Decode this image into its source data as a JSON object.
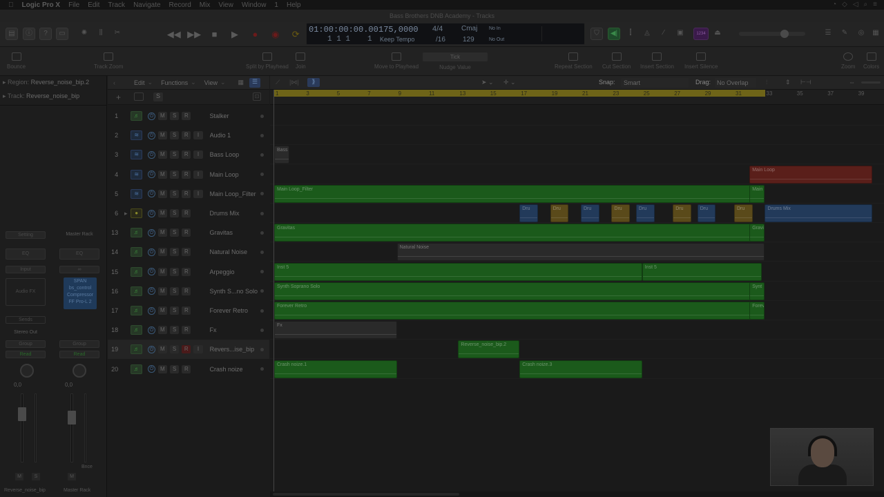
{
  "menubar": {
    "app_name": "Logic Pro X",
    "items": [
      "File",
      "Edit",
      "Track",
      "Navigate",
      "Record",
      "Mix",
      "View",
      "Window",
      "1",
      "Help"
    ]
  },
  "window": {
    "title": "Bass Brothers DNB Academy - Tracks"
  },
  "lcd": {
    "position": "01:00:00:00.00",
    "bars": "1  1  1",
    "beat_div": "1",
    "tempo": "175,0000",
    "tempo_mode": "Keep Tempo",
    "time_sig": "4/4",
    "division": "/16",
    "key": "Cmaj",
    "key_num": "129",
    "in": "No In",
    "out": "No Out",
    "badge": "1234"
  },
  "toolbar": {
    "bounce": "Bounce",
    "track_zoom": "Track Zoom",
    "split": "Split by Playhead",
    "join": "Join",
    "move": "Move to Playhead",
    "nudge": "Nudge Value",
    "nudge_value": "Tick",
    "repeat": "Repeat Section",
    "cut": "Cut Section",
    "insert": "Insert Section",
    "silence": "Insert Silence",
    "zoom": "Zoom",
    "colors": "Colors"
  },
  "inspector": {
    "region_label": "Region:",
    "region_value": "Reverse_noise_bip.2",
    "track_label": "Track:",
    "track_value": "Reverse_noise_bip",
    "strip1": {
      "setting": "Setting",
      "eq": "EQ",
      "input": "Input",
      "audio_fx": "Audio FX",
      "sends": "Sends",
      "output": "Stereo Out",
      "group": "Group",
      "read": "Read",
      "vol": "0,0",
      "m": "M",
      "s": "S",
      "name": "Reverse_noise_bip"
    },
    "strip2": {
      "setting": "Master Rack",
      "eq": "EQ",
      "plugins": [
        "SPAN",
        "bs_control",
        "Compressor",
        "FF Pro-L 2"
      ],
      "group": "Group",
      "read": "Read",
      "vol": "0,0",
      "m": "M",
      "bnce": "Bnce",
      "name": "Master Rack"
    }
  },
  "trackarea": {
    "edit": "Edit",
    "functions": "Functions",
    "view": "View",
    "s": "S",
    "snap_label": "Snap:",
    "snap_value": "Smart",
    "drag_label": "Drag:",
    "drag_value": "No Overlap"
  },
  "tracks": [
    {
      "num": "1",
      "name": "Stalker",
      "type": "midi"
    },
    {
      "num": "2",
      "name": "Audio 1",
      "type": "audio"
    },
    {
      "num": "3",
      "name": "Bass Loop",
      "type": "audio"
    },
    {
      "num": "4",
      "name": "Main Loop",
      "type": "audio"
    },
    {
      "num": "5",
      "name": "Main Loop_Filter",
      "type": "audio"
    },
    {
      "num": "6",
      "name": "Drums Mix",
      "type": "stack"
    },
    {
      "num": "13",
      "name": "Gravitas",
      "type": "midi"
    },
    {
      "num": "14",
      "name": "Natural Noise",
      "type": "midi"
    },
    {
      "num": "15",
      "name": "Arpeggio",
      "type": "midi"
    },
    {
      "num": "16",
      "name": "Synth S...no Solo",
      "type": "midi"
    },
    {
      "num": "17",
      "name": "Forever Retro",
      "type": "midi"
    },
    {
      "num": "18",
      "name": "Fx",
      "type": "midi"
    },
    {
      "num": "19",
      "name": "Revers...ise_bip",
      "type": "midi"
    },
    {
      "num": "20",
      "name": "Crash noize",
      "type": "midi"
    }
  ],
  "track_buttons": {
    "m": "M",
    "s": "S",
    "r": "R",
    "i": "I",
    "power": "⏻"
  },
  "ruler": {
    "bars": [
      "1",
      "3",
      "5",
      "7",
      "9",
      "11",
      "13",
      "15",
      "17",
      "19",
      "21",
      "23",
      "25",
      "27",
      "29",
      "31",
      "33",
      "35",
      "37",
      "39"
    ]
  },
  "regions": [
    {
      "lane": 2,
      "label": "Bass Broth",
      "start": 1,
      "end": 2,
      "color": "gr"
    },
    {
      "lane": 3,
      "label": "Main Loop",
      "start": 32,
      "end": 40,
      "color": "r"
    },
    {
      "lane": 4,
      "label": "Main Loop_Filter",
      "start": 1,
      "end": 33,
      "color": "g"
    },
    {
      "lane": 4,
      "label": "Main",
      "start": 32,
      "end": 33,
      "color": "g"
    },
    {
      "lane": 5,
      "label": "Dru",
      "start": 17,
      "end": 18.2,
      "color": "b"
    },
    {
      "lane": 5,
      "label": "Dru",
      "start": 19,
      "end": 20.2,
      "color": "y"
    },
    {
      "lane": 5,
      "label": "Dru",
      "start": 21,
      "end": 22.2,
      "color": "b"
    },
    {
      "lane": 5,
      "label": "Dru",
      "start": 23,
      "end": 24.2,
      "color": "y"
    },
    {
      "lane": 5,
      "label": "Dru",
      "start": 24.6,
      "end": 25.8,
      "color": "b"
    },
    {
      "lane": 5,
      "label": "Dru",
      "start": 27,
      "end": 28.2,
      "color": "y"
    },
    {
      "lane": 5,
      "label": "Dru",
      "start": 28.6,
      "end": 29.8,
      "color": "b"
    },
    {
      "lane": 5,
      "label": "Dru",
      "start": 31,
      "end": 32.2,
      "color": "y"
    },
    {
      "lane": 5,
      "label": "Drums Mix",
      "start": 33,
      "end": 40,
      "color": "b"
    },
    {
      "lane": 6,
      "label": "Gravitas",
      "start": 1,
      "end": 33,
      "color": "g"
    },
    {
      "lane": 6,
      "label": "Gravi",
      "start": 32,
      "end": 33,
      "color": "g"
    },
    {
      "lane": 7,
      "label": "Natural Noise",
      "start": 9,
      "end": 33,
      "color": "gr"
    },
    {
      "lane": 8,
      "label": "Inst 5",
      "start": 1,
      "end": 25,
      "color": "g"
    },
    {
      "lane": 8,
      "label": "Inst 5",
      "start": 25,
      "end": 32.8,
      "color": "g"
    },
    {
      "lane": 9,
      "label": "Synth Soprano Solo",
      "start": 1,
      "end": 33,
      "color": "g"
    },
    {
      "lane": 9,
      "label": "Synt",
      "start": 32,
      "end": 33,
      "color": "g"
    },
    {
      "lane": 10,
      "label": "Forever Retro",
      "start": 1,
      "end": 33,
      "color": "g"
    },
    {
      "lane": 10,
      "label": "Forev",
      "start": 32,
      "end": 33,
      "color": "g"
    },
    {
      "lane": 11,
      "label": "Fx",
      "start": 1,
      "end": 9,
      "color": "gr"
    },
    {
      "lane": 12,
      "label": "Reverse_noise_bip.2",
      "start": 13,
      "end": 17,
      "color": "g"
    },
    {
      "lane": 13,
      "label": "Crash noize.1",
      "start": 1,
      "end": 9,
      "color": "g"
    },
    {
      "lane": 13,
      "label": "Crash noize.3",
      "start": 17,
      "end": 25,
      "color": "g"
    }
  ]
}
